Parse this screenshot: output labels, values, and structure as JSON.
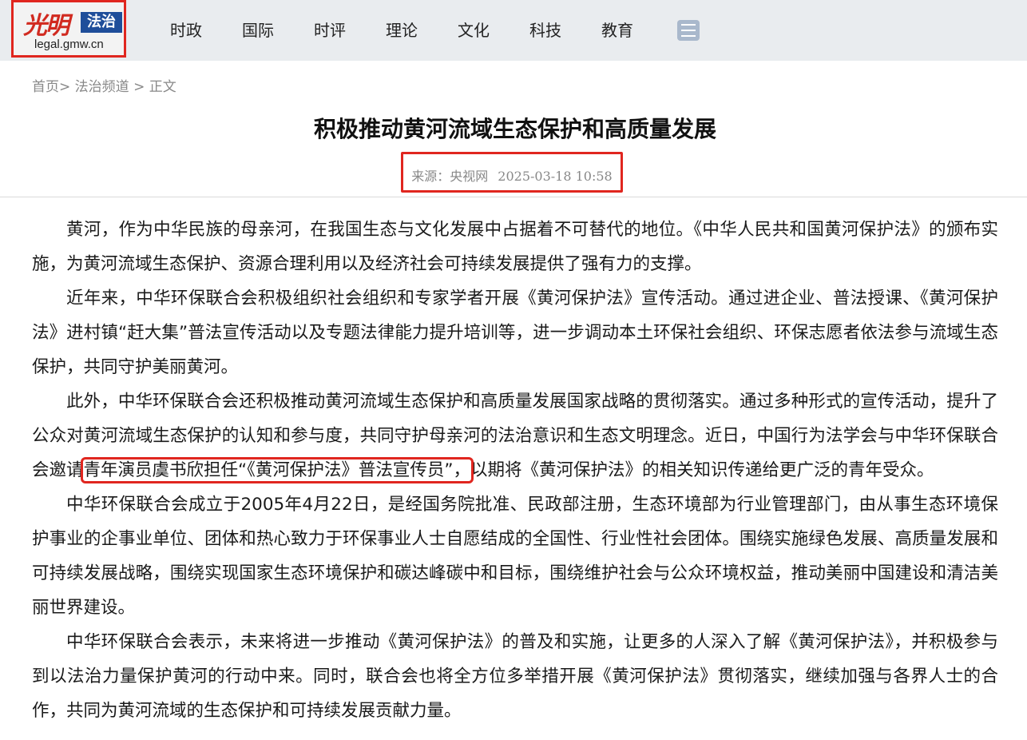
{
  "header": {
    "logo_script": "光明",
    "logo_box": "法治",
    "logo_domain": "legal.gmw.cn",
    "nav": [
      "时政",
      "国际",
      "时评",
      "理论",
      "文化",
      "科技",
      "教育"
    ]
  },
  "breadcrumb": {
    "home": "首页",
    "sep1": ">",
    "channel": "法治频道",
    "sep2": ">",
    "current": "正文"
  },
  "article": {
    "title": "积极推动黄河流域生态保护和高质量发展",
    "source": "来源：央视网",
    "datetime": "2025-03-18 10:58",
    "p1": "黄河，作为中华民族的母亲河，在我国生态与文化发展中占据着不可替代的地位。《中华人民共和国黄河保护法》的颁布实施，为黄河流域生态保护、资源合理利用以及经济社会可持续发展提供了强有力的支撑。",
    "p2": "近年来，中华环保联合会积极组织社会组织和专家学者开展《黄河保护法》宣传活动。通过进企业、普法授课、《黄河保护法》进村镇“赶大集”普法宣传活动以及专题法律能力提升培训等，进一步调动本土环保社会组织、环保志愿者依法参与流域生态保护，共同守护美丽黄河。",
    "p3_before": "此外，中华环保联合会还积极推动黄河流域生态保护和高质量发展国家战略的贯彻落实。通过多种形式的宣传活动，提升了公众对黄河流域生态保护的认知和参与度，共同守护母亲河的法治意识和生态文明理念。近日，中国行为法学会与中华环保联合会邀请",
    "p3_highlight": "青年演员虞书欣担任“《黄河保护法》普法宣传员”，",
    "p3_after": "以期将《黄河保护法》的相关知识传递给更广泛的青年受众。",
    "p4": "中华环保联合会成立于2005年4月22日，是经国务院批准、民政部注册，生态环境部为行业管理部门，由从事生态环境保护事业的企事业单位、团体和热心致力于环保事业人士自愿结成的全国性、行业性社会团体。围绕实施绿色发展、高质量发展和可持续发展战略，围绕实现国家生态环境保护和碳达峰碳中和目标，围绕维护社会与公众环境权益，推动美丽中国建设和清洁美丽世界建设。",
    "p5": "中华环保联合会表示，未来将进一步推动《黄河保护法》的普及和实施，让更多的人深入了解《黄河保护法》，并积极参与到以法治力量保护黄河的行动中来。同时，联合会也将全方位多举措开展《黄河保护法》贯彻落实，继续加强与各界人士的合作，共同为黄河流域的生态保护和可持续发展贡献力量。"
  },
  "colors": {
    "highlight_border": "#e0261f",
    "logo_box": "#1f4e9a",
    "header_bg": "#e9ecef"
  }
}
